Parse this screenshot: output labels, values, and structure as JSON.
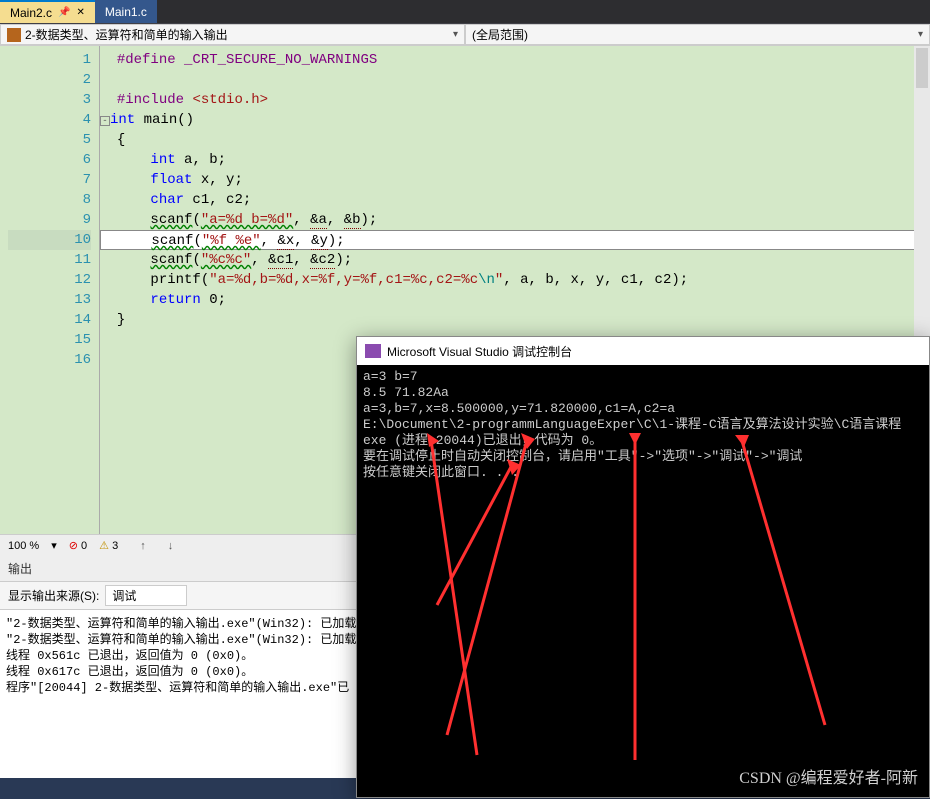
{
  "tabs": {
    "active": "Main2.c",
    "inactive": "Main1.c"
  },
  "subtoolbar": {
    "left": "2-数据类型、运算符和简单的输入输出",
    "right": "(全局范围)"
  },
  "code": {
    "lines": [
      1,
      2,
      3,
      4,
      5,
      6,
      7,
      8,
      9,
      10,
      11,
      12,
      13,
      14,
      15,
      16
    ],
    "l1_a": "#define",
    "l1_b": "_CRT_SECURE_NO_WARNINGS",
    "l3_a": "#include ",
    "l3_b": "<stdio.h>",
    "l4_a": "int",
    "l4_b": " main()",
    "l5": "{",
    "l6_a": "int",
    "l6_b": " a, b;",
    "l7_a": "float",
    "l7_b": " x, y;",
    "l8_a": "char",
    "l8_b": " c1, c2;",
    "l9_a": "scanf",
    "l9_b": "(",
    "l9_c": "\"a=%d b=%d\"",
    "l9_d": ", ",
    "l9_e": "&a",
    "l9_f": ", ",
    "l9_g": "&b",
    "l9_h": ");",
    "l10_a": "scanf",
    "l10_b": "(",
    "l10_c": "\"%f %e\"",
    "l10_d": ", ",
    "l10_e": "&x",
    "l10_f": ", ",
    "l10_g": "&y",
    "l10_h": ");",
    "l11_a": "scanf",
    "l11_b": "(",
    "l11_c": "\"%c%c\"",
    "l11_d": ", ",
    "l11_e": "&c1",
    "l11_f": ", ",
    "l11_g": "&c2",
    "l11_h": ");",
    "l12_a": "printf",
    "l12_b": "(",
    "l12_c": "\"a=%d,b=%d,x=%f,y=%f,c1=%c,c2=%c",
    "l12_d": "\\n",
    "l12_e": "\"",
    "l12_f": ", a, b, x, y, c1, c2);",
    "l13_a": "return",
    "l13_b": " 0;",
    "l14": "}"
  },
  "status": {
    "zoom": "100 %",
    "errors": "0",
    "warnings": "3"
  },
  "output_panel": {
    "title": "输出",
    "source_label": "显示输出来源(S):",
    "source": "调试",
    "lines": [
      "\"2-数据类型、运算符和简单的输入输出.exe\"(Win32):  已加载",
      "\"2-数据类型、运算符和简单的输入输出.exe\"(Win32):  已加载",
      "线程 0x561c 已退出，返回值为 0 (0x0)。",
      "线程 0x617c 已退出，返回值为 0 (0x0)。",
      "程序\"[20044] 2-数据类型、运算符和简单的输入输出.exe\"已"
    ]
  },
  "console": {
    "title": "Microsoft Visual Studio 调试控制台",
    "lines": [
      "a=3 b=7",
      "8.5 71.82Aa",
      "a=3,b=7,x=8.500000,y=71.820000,c1=A,c2=a",
      "",
      "E:\\Document\\2-programmLanguageExper\\C\\1-课程-C语言及算法设计实验\\C语言课程",
      "exe (进程 20044)已退出，代码为 0。",
      "要在调试停止时自动关闭控制台，请启用\"工具\"->\"选项\"->\"调试\"->\"调试",
      "按任意键关闭此窗口. . ."
    ]
  },
  "watermark": "CSDN @编程爱好者-阿新"
}
